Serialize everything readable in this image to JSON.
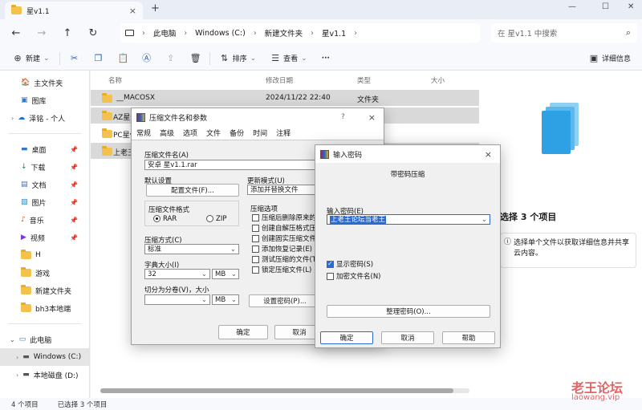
{
  "window": {
    "tab_title": "星v1.1",
    "close_tab": "×",
    "new_tab": "+",
    "min": "—",
    "max": "☐",
    "close": "✕"
  },
  "address": {
    "crumbs": [
      "此电脑",
      "Windows (C:)",
      "新建文件夹",
      "星v1.1"
    ],
    "search_placeholder": "在 星v1.1 中搜索"
  },
  "toolbar": {
    "new": "新建",
    "sort": "排序",
    "view": "查看",
    "more": "···",
    "details": "详细信息"
  },
  "sidebar": {
    "top": [
      {
        "label": "主文件夹"
      },
      {
        "label": "图库"
      },
      {
        "label": "泽铭 - 个人"
      }
    ],
    "pinned": [
      {
        "label": "桌面"
      },
      {
        "label": "下载"
      },
      {
        "label": "文档"
      },
      {
        "label": "图片"
      },
      {
        "label": "音乐"
      },
      {
        "label": "视频"
      },
      {
        "label": "H"
      },
      {
        "label": "游戏"
      },
      {
        "label": "新建文件夹"
      },
      {
        "label": "bh3本地端"
      }
    ],
    "pc": {
      "label": "此电脑"
    },
    "drives": [
      {
        "label": "Windows (C:)"
      },
      {
        "label": "本地磁盘 (D:)"
      }
    ]
  },
  "filelist": {
    "columns": [
      "名称",
      "修改日期",
      "类型",
      "大小"
    ],
    "rows": [
      {
        "name": "__MACOSX",
        "date": "2024/11/22 22:40",
        "type": "文件夹"
      },
      {
        "name": "AZ星v"
      },
      {
        "name": "PC星v"
      },
      {
        "name": "上老王"
      }
    ]
  },
  "details": {
    "heading": "选择 3 个项目",
    "info": "选择单个文件以获取详细信息并共享云内容。"
  },
  "status": {
    "count": "4 个项目",
    "selected": "已选择 3 个项目"
  },
  "rar_dialog": {
    "title": "压缩文件名和参数",
    "help": "?",
    "close": "×",
    "tabs": [
      "常规",
      "高级",
      "选项",
      "文件",
      "备份",
      "时间",
      "注释"
    ],
    "archive_name_label": "压缩文件名(A)",
    "archive_name": "安卓 星v1.1.rar",
    "default_settings_label": "默认设置",
    "profiles_btn": "配置文件(F)...",
    "update_mode_label": "更新模式(U)",
    "update_mode": "添加并替换文件",
    "format_label": "压缩文件格式",
    "format_rar": "RAR",
    "format_zip": "ZIP",
    "options_label": "压缩选项",
    "options": [
      "压缩后删除原来的文件",
      "创建自解压格式压缩文件",
      "创建固实压缩文件(S)",
      "添加恢复记录(E)",
      "测试压缩的文件(T)",
      "锁定压缩文件(L)"
    ],
    "method_label": "压缩方式(C)",
    "method": "标准",
    "dict_label": "字典大小(I)",
    "dict_value": "32",
    "dict_unit": "MB",
    "split_label": "切分为分卷(V)，大小",
    "split_unit": "MB",
    "set_password_btn": "设置密码(P)...",
    "ok": "确定",
    "cancel": "取消"
  },
  "password_dialog": {
    "title": "输入密码",
    "close": "×",
    "subtitle": "带密码压缩",
    "input_label": "输入密码(E)",
    "input_value": "上老王论坛当老王",
    "show_password": "显示密码(S)",
    "encrypt_names": "加密文件名(N)",
    "organize_btn": "整理密码(O)...",
    "ok": "确定",
    "cancel": "取消",
    "help": "帮助"
  },
  "watermark": {
    "cn": "老王论坛",
    "en": "laowang.vip"
  },
  "colors": {
    "accent": "#2a6bd1",
    "folder": "#f3c24c",
    "selection": "#cce4f7"
  }
}
